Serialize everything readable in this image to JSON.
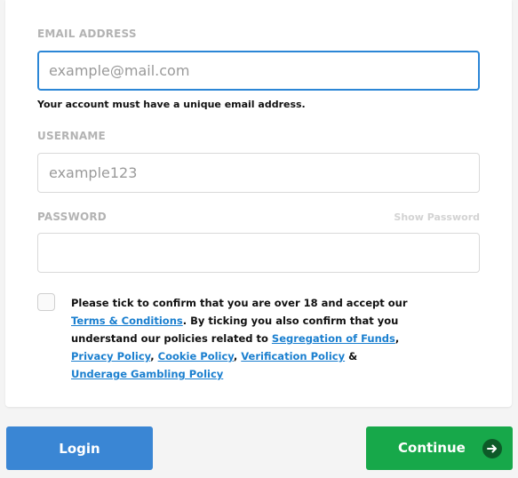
{
  "form": {
    "email": {
      "label": "EMAIL ADDRESS",
      "placeholder": "example@mail.com",
      "value": "",
      "helper": "Your account must have a unique email address."
    },
    "username": {
      "label": "USERNAME",
      "placeholder": "example123",
      "value": ""
    },
    "password": {
      "label": "PASSWORD",
      "placeholder": "",
      "value": "",
      "show_password": "Show Password"
    },
    "terms": {
      "text_1": "Please tick to confirm that you are over 18 and accept our ",
      "link_terms": "Terms & Conditions",
      "text_2": ". By ticking you also confirm that you understand our policies related to ",
      "link_segregation": "Segregation of Funds",
      "text_3": ", ",
      "link_privacy": "Privacy Policy",
      "text_4": ", ",
      "link_cookie": "Cookie Policy",
      "text_5": ", ",
      "link_verification": "Verification Policy",
      "text_6": " & ",
      "link_gambling": "Underage Gambling Policy",
      "checked": false
    }
  },
  "actions": {
    "login_label": "Login",
    "continue_label": "Continue"
  },
  "colors": {
    "focus_border": "#2b86d6",
    "login_button": "#3a86d4",
    "continue_button": "#17a84a",
    "link": "#1a7fcf"
  },
  "icons": {
    "continue": "arrow-right-circle-icon"
  }
}
